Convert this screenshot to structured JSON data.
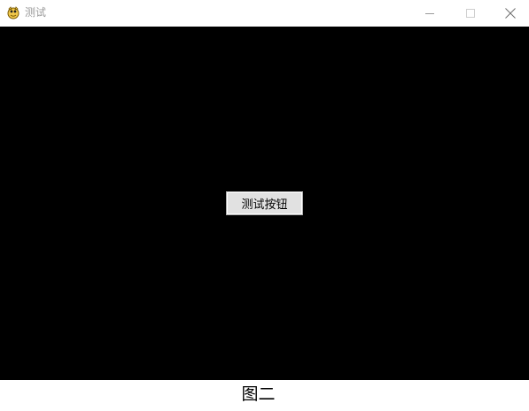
{
  "window": {
    "title": "测试",
    "icon": "pygame-snake-icon",
    "controls": {
      "minimize": "minimize-icon",
      "maximize": "maximize-icon",
      "close": "close-icon"
    }
  },
  "canvas": {
    "background": "#000000",
    "button_label": "测试按钮"
  },
  "caption": "图二",
  "colors": {
    "titlebar": "#ffffff",
    "title_text": "#9a9a9a",
    "button_face": "#e1e1e1",
    "button_border": "#adadad"
  }
}
